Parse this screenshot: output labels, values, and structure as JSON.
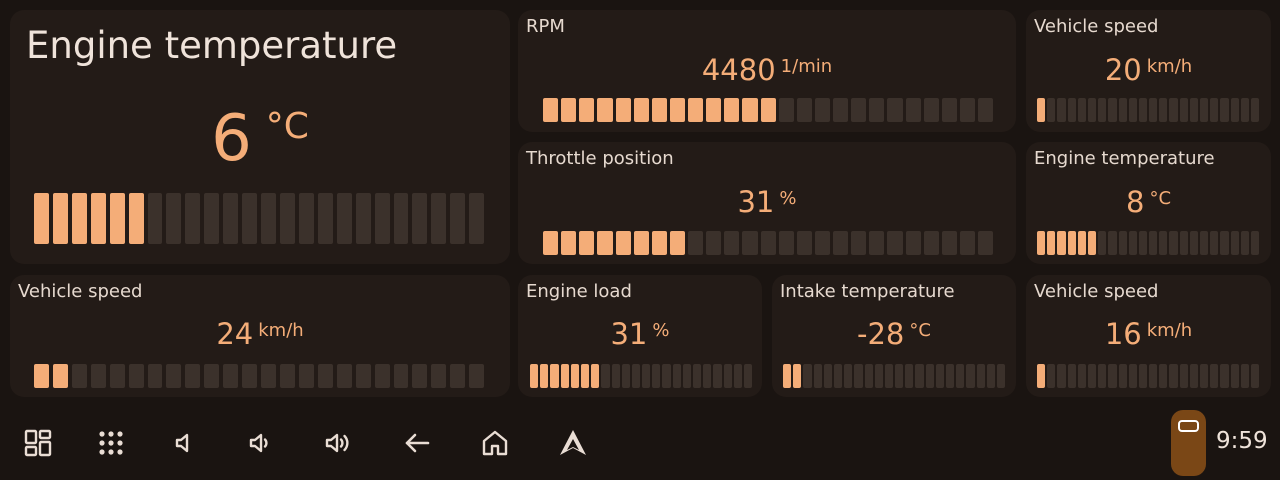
{
  "colors": {
    "background": "#1a1411",
    "card": "#231b17",
    "accent": "#f4ad78",
    "bar_off": "#3b312b",
    "car_button": "#7a4716"
  },
  "widgets": [
    {
      "id": "engine-temp-big",
      "title": "Engine temperature",
      "value": "6",
      "unit": "°C",
      "level": 0.25,
      "segments": 24
    },
    {
      "id": "rpm",
      "title": "RPM",
      "value": "4480",
      "unit": "1/min",
      "level": 0.52,
      "segments": 25
    },
    {
      "id": "speed-top",
      "title": "Vehicle speed",
      "value": "20",
      "unit": "km/h",
      "level": 0.05,
      "segments": 22
    },
    {
      "id": "throttle",
      "title": "Throttle position",
      "value": "31",
      "unit": "%",
      "level": 0.31,
      "segments": 25
    },
    {
      "id": "engine-temp-small",
      "title": "Engine temperature",
      "value": "8",
      "unit": "°C",
      "level": 0.26,
      "segments": 22
    },
    {
      "id": "speed-left",
      "title": "Vehicle speed",
      "value": "24",
      "unit": "km/h",
      "level": 0.09,
      "segments": 24
    },
    {
      "id": "engine-load",
      "title": "Engine load",
      "value": "31",
      "unit": "%",
      "level": 0.3,
      "segments": 22
    },
    {
      "id": "intake-temp",
      "title": "Intake temperature",
      "value": "-28",
      "unit": "°C",
      "level": 0.09,
      "segments": 22
    },
    {
      "id": "speed-bottom",
      "title": "Vehicle speed",
      "value": "16",
      "unit": "km/h",
      "level": 0.05,
      "segments": 22
    }
  ],
  "nav": {
    "icons": [
      "dashboard-grid-icon",
      "app-launcher-icon",
      "volume-mute-icon",
      "volume-down-icon",
      "volume-up-icon",
      "back-arrow-icon",
      "home-icon",
      "android-auto-icon"
    ]
  },
  "status": {
    "time": "9:59",
    "car_icon": "car-icon"
  }
}
